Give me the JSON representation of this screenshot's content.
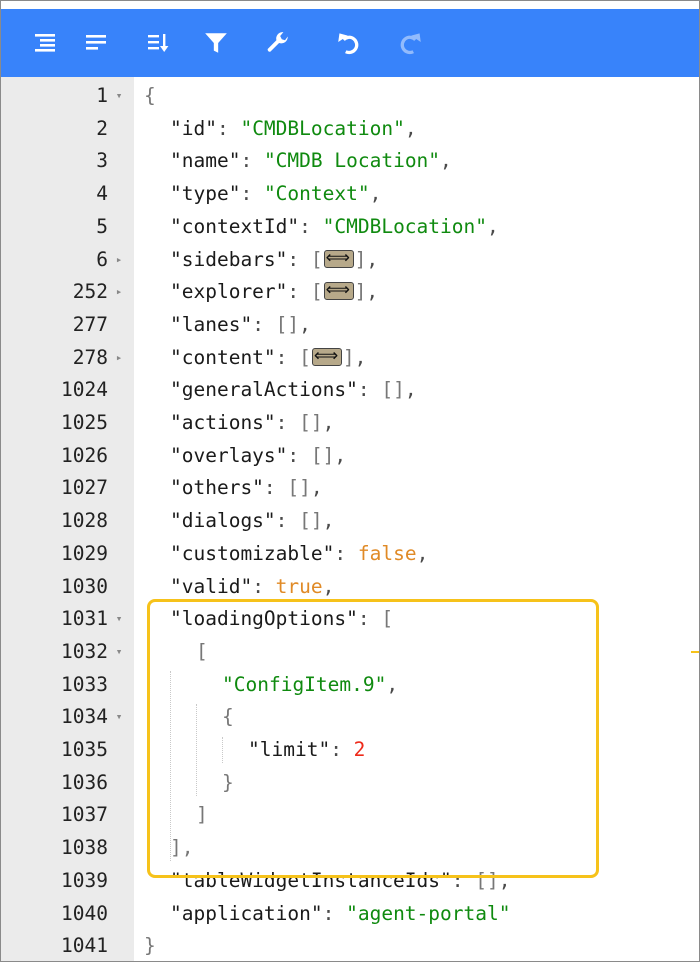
{
  "toolbar": {
    "buttons": [
      {
        "name": "format-icon"
      },
      {
        "name": "compact-icon"
      },
      {
        "name": "sort-icon"
      },
      {
        "name": "filter-icon"
      },
      {
        "name": "repair-icon"
      },
      {
        "name": "undo-icon"
      },
      {
        "name": "redo-icon"
      }
    ],
    "bg_color": "#3883fa"
  },
  "lines": [
    {
      "ln": "1",
      "fold": "▾",
      "text": "{"
    },
    {
      "ln": "2",
      "key": "\"id\"",
      "val": "\"CMDBLocation\"",
      "end": ","
    },
    {
      "ln": "3",
      "key": "\"name\"",
      "val": "\"CMDB Location\"",
      "end": ","
    },
    {
      "ln": "4",
      "key": "\"type\"",
      "val": "\"Context\"",
      "end": ","
    },
    {
      "ln": "5",
      "key": "\"contextId\"",
      "val": "\"CMDBLocation\"",
      "end": ","
    },
    {
      "ln": "6",
      "fold": "▸",
      "key": "\"sidebars\"",
      "end": ","
    },
    {
      "ln": "252",
      "fold": "▸",
      "key": "\"explorer\"",
      "end": ","
    },
    {
      "ln": "277",
      "key": "\"lanes\"",
      "val": "[]",
      "end": ","
    },
    {
      "ln": "278",
      "fold": "▸",
      "key": "\"content\"",
      "end": ","
    },
    {
      "ln": "1024",
      "key": "\"generalActions\"",
      "val": "[]",
      "end": ","
    },
    {
      "ln": "1025",
      "key": "\"actions\"",
      "val": "[]",
      "end": ","
    },
    {
      "ln": "1026",
      "key": "\"overlays\"",
      "val": "[]",
      "end": ","
    },
    {
      "ln": "1027",
      "key": "\"others\"",
      "val": "[]",
      "end": ","
    },
    {
      "ln": "1028",
      "key": "\"dialogs\"",
      "val": "[]",
      "end": ","
    },
    {
      "ln": "1029",
      "key": "\"customizable\"",
      "val": "false",
      "end": ","
    },
    {
      "ln": "1030",
      "key": "\"valid\"",
      "val": "true",
      "end": ","
    },
    {
      "ln": "1031",
      "fold": "▾",
      "key": "\"loadingOptions\"",
      "val": "["
    },
    {
      "ln": "1032",
      "fold": "▾",
      "text": "["
    },
    {
      "ln": "1033",
      "val": "\"ConfigItem.9\"",
      "end": ","
    },
    {
      "ln": "1034",
      "fold": "▾",
      "text": "{"
    },
    {
      "ln": "1035",
      "key": "\"limit\"",
      "val": "2"
    },
    {
      "ln": "1036",
      "text": "}"
    },
    {
      "ln": "1037",
      "text": "]"
    },
    {
      "ln": "1038",
      "text": "],"
    },
    {
      "ln": "1039",
      "key": "\"tableWidgetInstanceIds\"",
      "val": "[]",
      "end": ","
    },
    {
      "ln": "1040",
      "key": "\"application\"",
      "val": "\"agent-portal\""
    },
    {
      "ln": "1041",
      "text": "}"
    }
  ],
  "colors": {
    "key": "#1a1a1a",
    "string": "#0f8a0f",
    "number": "#ee2a1a",
    "boolean": "#e08a26",
    "gutter": "#ebebeb",
    "highlight": "#f6c21a"
  }
}
